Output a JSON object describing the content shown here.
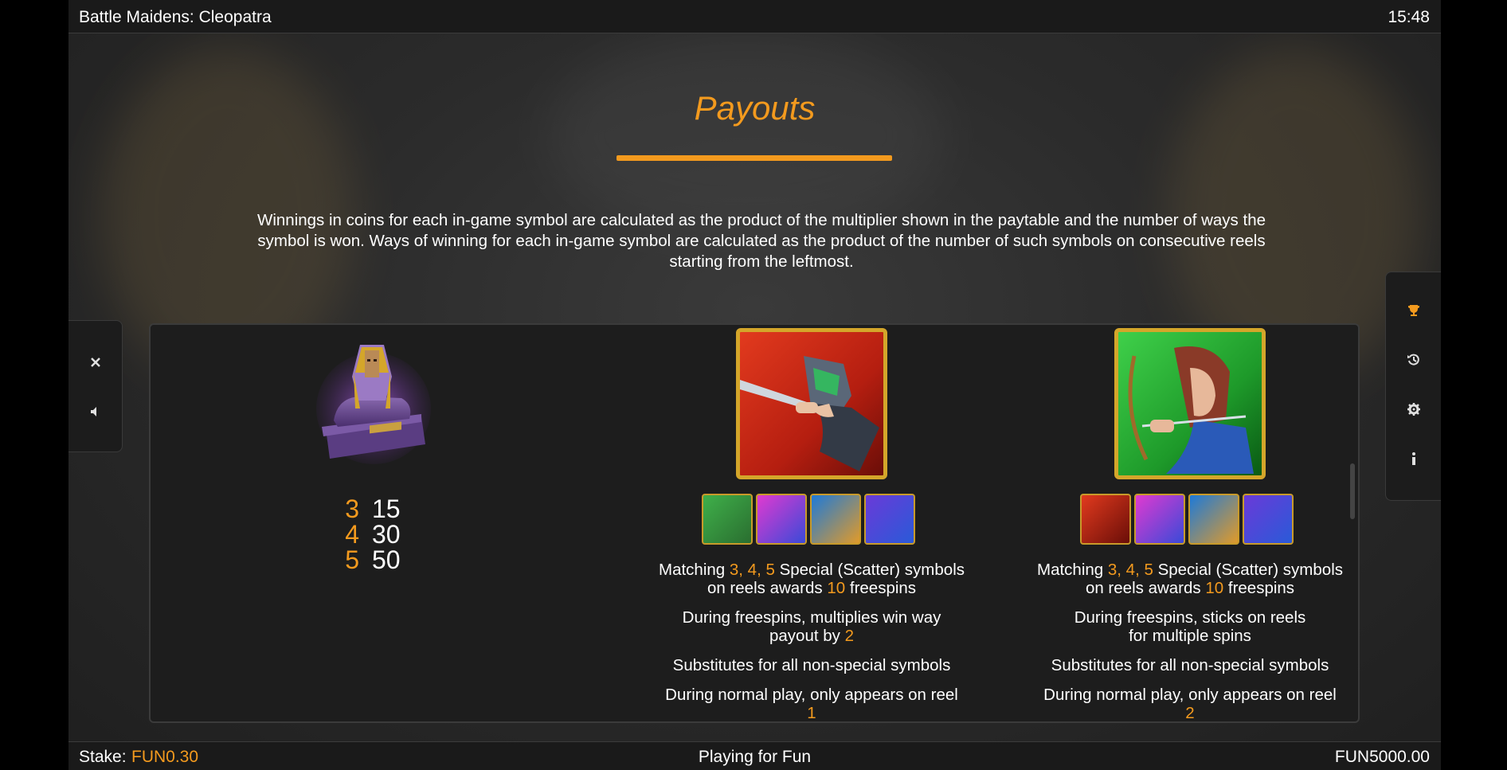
{
  "header": {
    "title": "Battle Maidens: Cleopatra",
    "time": "15:48"
  },
  "page": {
    "title": "Payouts",
    "intro": "Winnings in coins for each in-game symbol are calculated as the product of the multiplier shown in the paytable and the number of ways the symbol is won. Ways of winning for each in-game symbol are calculated as the product of the number of such symbols on consecutive reels starting from the leftmost."
  },
  "left_controls": [
    {
      "icon": "close-icon"
    },
    {
      "icon": "sound-icon"
    }
  ],
  "right_controls": [
    {
      "icon": "trophy-icon"
    },
    {
      "icon": "history-icon"
    },
    {
      "icon": "settings-icon"
    },
    {
      "icon": "info-icon"
    }
  ],
  "symbols": {
    "sphinx": {
      "payouts": [
        {
          "count": "3",
          "value": "15"
        },
        {
          "count": "4",
          "value": "30"
        },
        {
          "count": "5",
          "value": "50"
        }
      ]
    },
    "scatter1": {
      "line1_a": "Matching ",
      "line1_hl": "3, 4, 5",
      "line1_b": " Special (Scatter) symbols",
      "line2_a": "on reels awards ",
      "line2_hl": "10",
      "line2_b": " freespins",
      "p2_a": "During freespins, multiplies win way payout by ",
      "p2_hl": "2",
      "p3": "Substitutes for all non-special symbols",
      "p4_a": "During normal play, only appears on reel",
      "p4_hl": "1"
    },
    "scatter2": {
      "line1_a": "Matching ",
      "line1_hl": "3, 4, 5",
      "line1_b": " Special (Scatter) symbols",
      "line2_a": "on reels awards ",
      "line2_hl": "10",
      "line2_b": " freespins",
      "p2_a": "During freespins, sticks on reels for multiple spins",
      "p3": "Substitutes for all non-special symbols",
      "p4_a": "During normal play, only appears on reel",
      "p4_hl": "2"
    }
  },
  "footer": {
    "stake_label": "Stake:",
    "stake_value": "FUN0.30",
    "mode": "Playing for Fun",
    "balance": "FUN5000.00"
  },
  "colors": {
    "accent": "#f39a1e",
    "gold": "#d4a62a"
  }
}
